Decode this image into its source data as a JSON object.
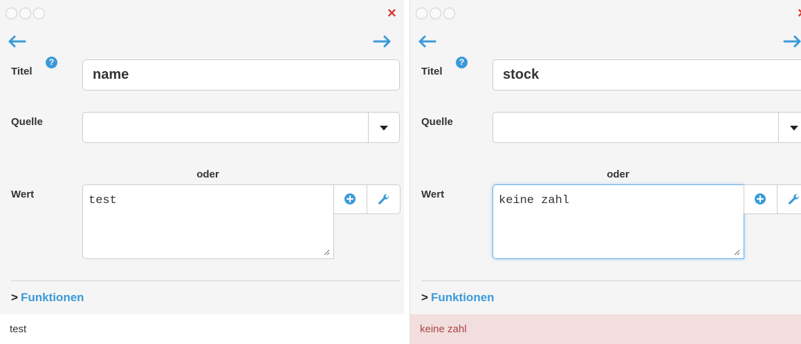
{
  "panels": [
    {
      "titel_label": "Titel",
      "help_glyph": "?",
      "title_value": "name",
      "quelle_label": "Quelle",
      "quelle_value": "",
      "oder_label": "oder",
      "wert_label": "Wert",
      "wert_value": "test",
      "funktionen_chevron": ">",
      "funktionen_label": "Funktionen",
      "result_text": "test",
      "result_state": "ok"
    },
    {
      "titel_label": "Titel",
      "help_glyph": "?",
      "title_value": "stock",
      "quelle_label": "Quelle",
      "quelle_value": "",
      "oder_label": "oder",
      "wert_label": "Wert",
      "wert_value": "keine zahl",
      "funktionen_chevron": ">",
      "funktionen_label": "Funktionen",
      "result_text": "keine zahl",
      "result_state": "error"
    }
  ],
  "close_glyph": "×",
  "icons": [
    "window-dot-icon",
    "close-icon",
    "arrow-left-icon",
    "arrow-right-icon",
    "help-icon",
    "chevron-down-icon",
    "plus-circle-icon",
    "wrench-icon",
    "chevron-right-icon"
  ],
  "colors": {
    "accent_blue": "#3a9ad9",
    "close_red": "#d9392f",
    "error_bg": "#f2dede",
    "error_text": "#a94442",
    "focus_border": "#66afe9"
  }
}
